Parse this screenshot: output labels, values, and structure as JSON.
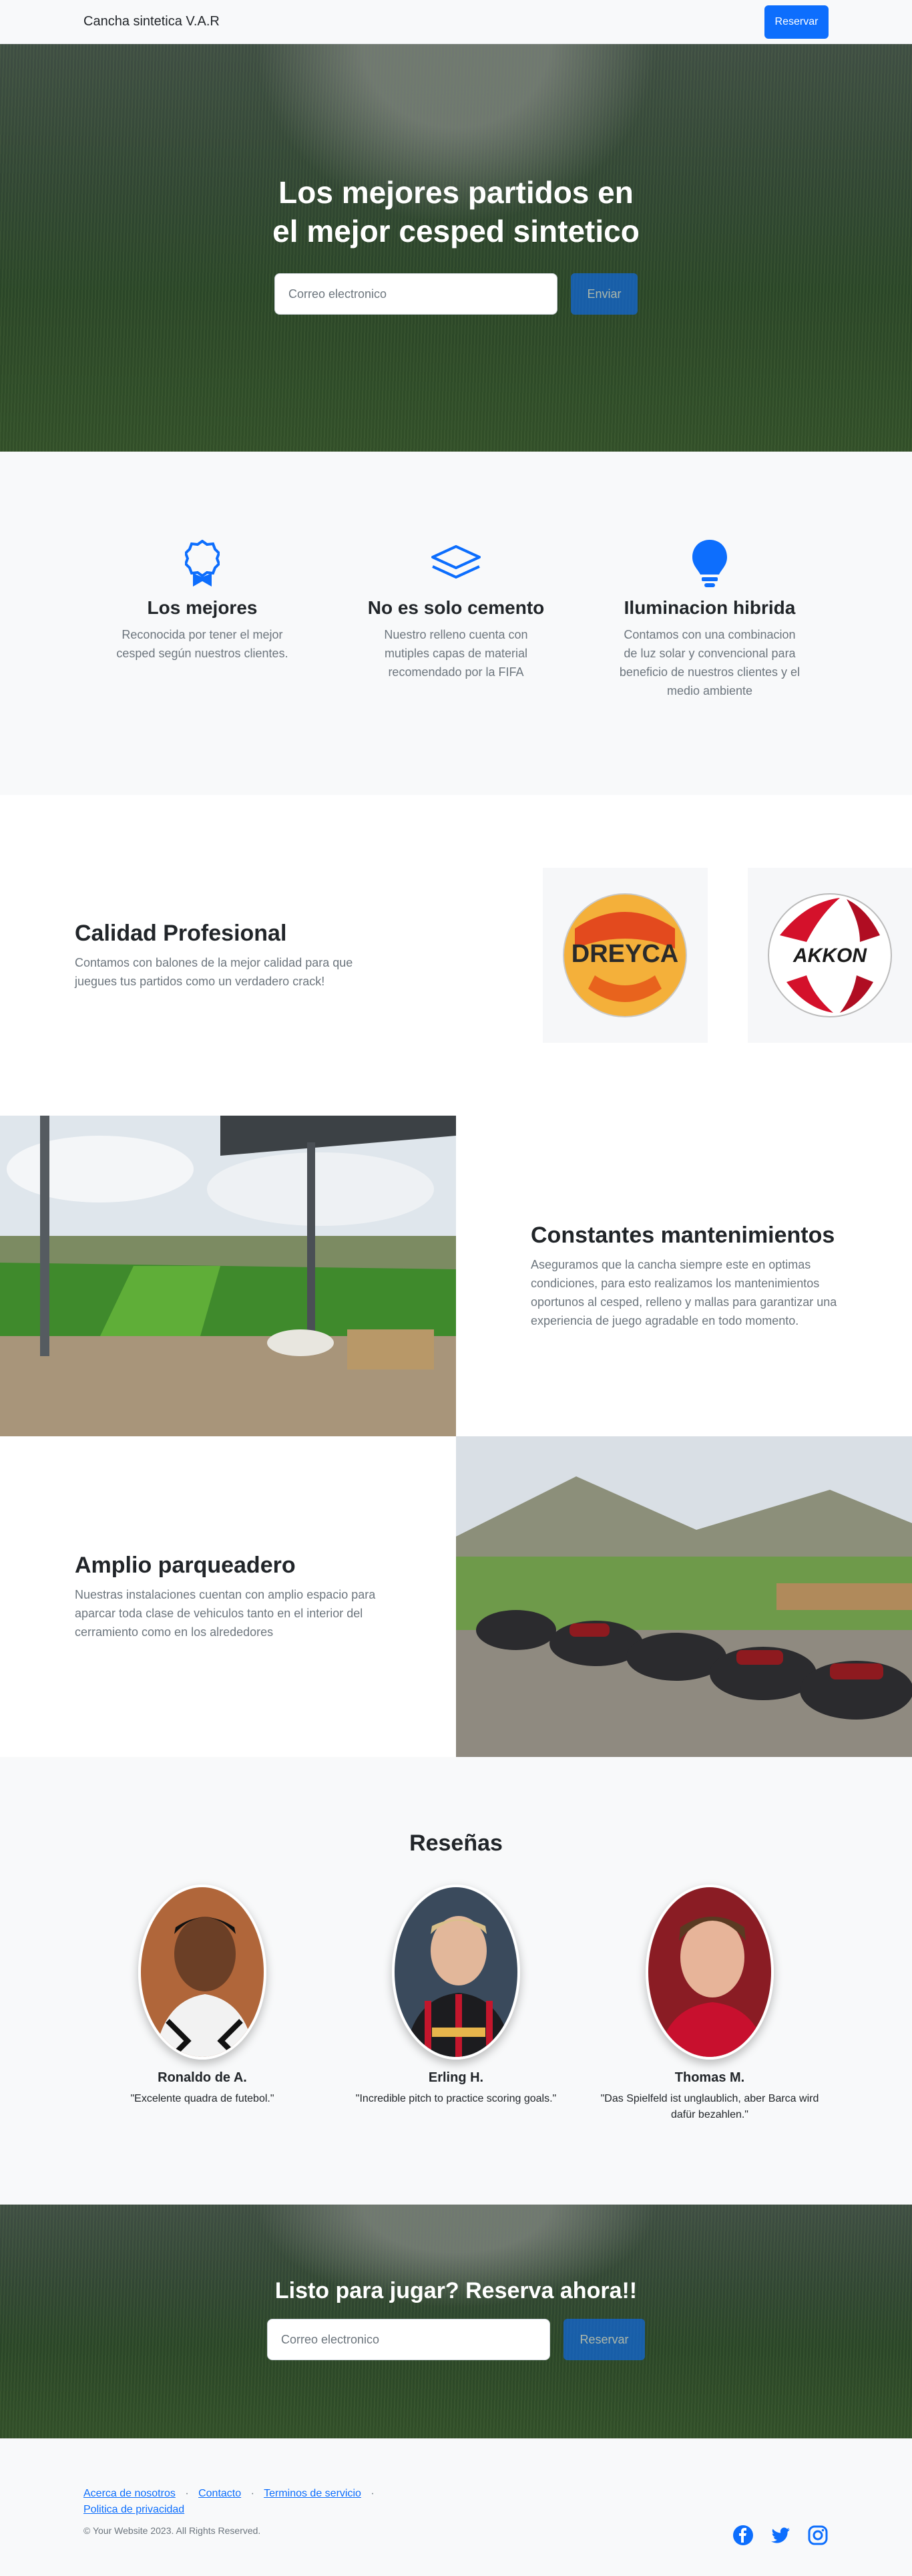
{
  "navbar": {
    "brand": "Cancha sintetica V.A.R",
    "reserve_label": "Reservar"
  },
  "hero": {
    "title_line1": "Los mejores partidos en",
    "title_line2": "el mejor cesped sintetico",
    "email_placeholder": "Correo electronico",
    "submit_label": "Enviar"
  },
  "features": [
    {
      "icon": "award-icon",
      "title": "Los mejores",
      "text": "Reconocida por tener el mejor cesped según nuestros clientes."
    },
    {
      "icon": "layers-icon",
      "title": "No es solo cemento",
      "text": "Nuestro relleno cuenta con mutiples capas de material recomendado por la FIFA"
    },
    {
      "icon": "lightbulb-icon",
      "title": "Iluminacion hibrida",
      "text": "Contamos con una combinacion de luz solar y convencional para beneficio de nuestros clientes y el medio ambiente"
    }
  ],
  "showcase": [
    {
      "title": "Calidad Profesional",
      "text": "Contamos con balones de la mejor calidad para que juegues tus partidos como un verdadero crack!",
      "ball1": "DREYCA",
      "ball2": "AKKON"
    },
    {
      "title": "Constantes mantenimientos",
      "text": "Aseguramos que la cancha siempre este en optimas condiciones, para esto realizamos los mantenimientos oportunos al cesped, relleno y mallas para garantizar una experiencia de juego agradable en todo momento."
    },
    {
      "title": "Amplio parqueadero",
      "text": "Nuestras instalaciones cuentan con amplio espacio para aparcar toda clase de vehiculos tanto en el interior del cerramiento como en los alrededores"
    }
  ],
  "reviews": {
    "title": "Reseñas",
    "items": [
      {
        "name": "Ronaldo de A.",
        "quote": "\"Excelente quadra de futebol.\""
      },
      {
        "name": "Erling H.",
        "quote": "\"Incredible pitch to practice scoring goals.\""
      },
      {
        "name": "Thomas M.",
        "quote": "\"Das Spielfeld ist unglaublich, aber Barca wird dafür bezahlen.\""
      }
    ]
  },
  "cta": {
    "title": "Listo para jugar? Reserva ahora!!",
    "email_placeholder": "Correo electronico",
    "submit_label": "Reservar"
  },
  "footer": {
    "links": [
      "Acerca de nosotros",
      "Contacto",
      "Terminos de servicio",
      "Politica de privacidad"
    ],
    "separator": "·",
    "copyright": "© Your Website 2023. All Rights Reserved.",
    "social_icons": [
      "facebook-icon",
      "twitter-icon",
      "instagram-icon"
    ]
  },
  "colors": {
    "primary": "#0d6efd",
    "muted": "#6c757d",
    "light_bg": "#f8f9fa"
  }
}
